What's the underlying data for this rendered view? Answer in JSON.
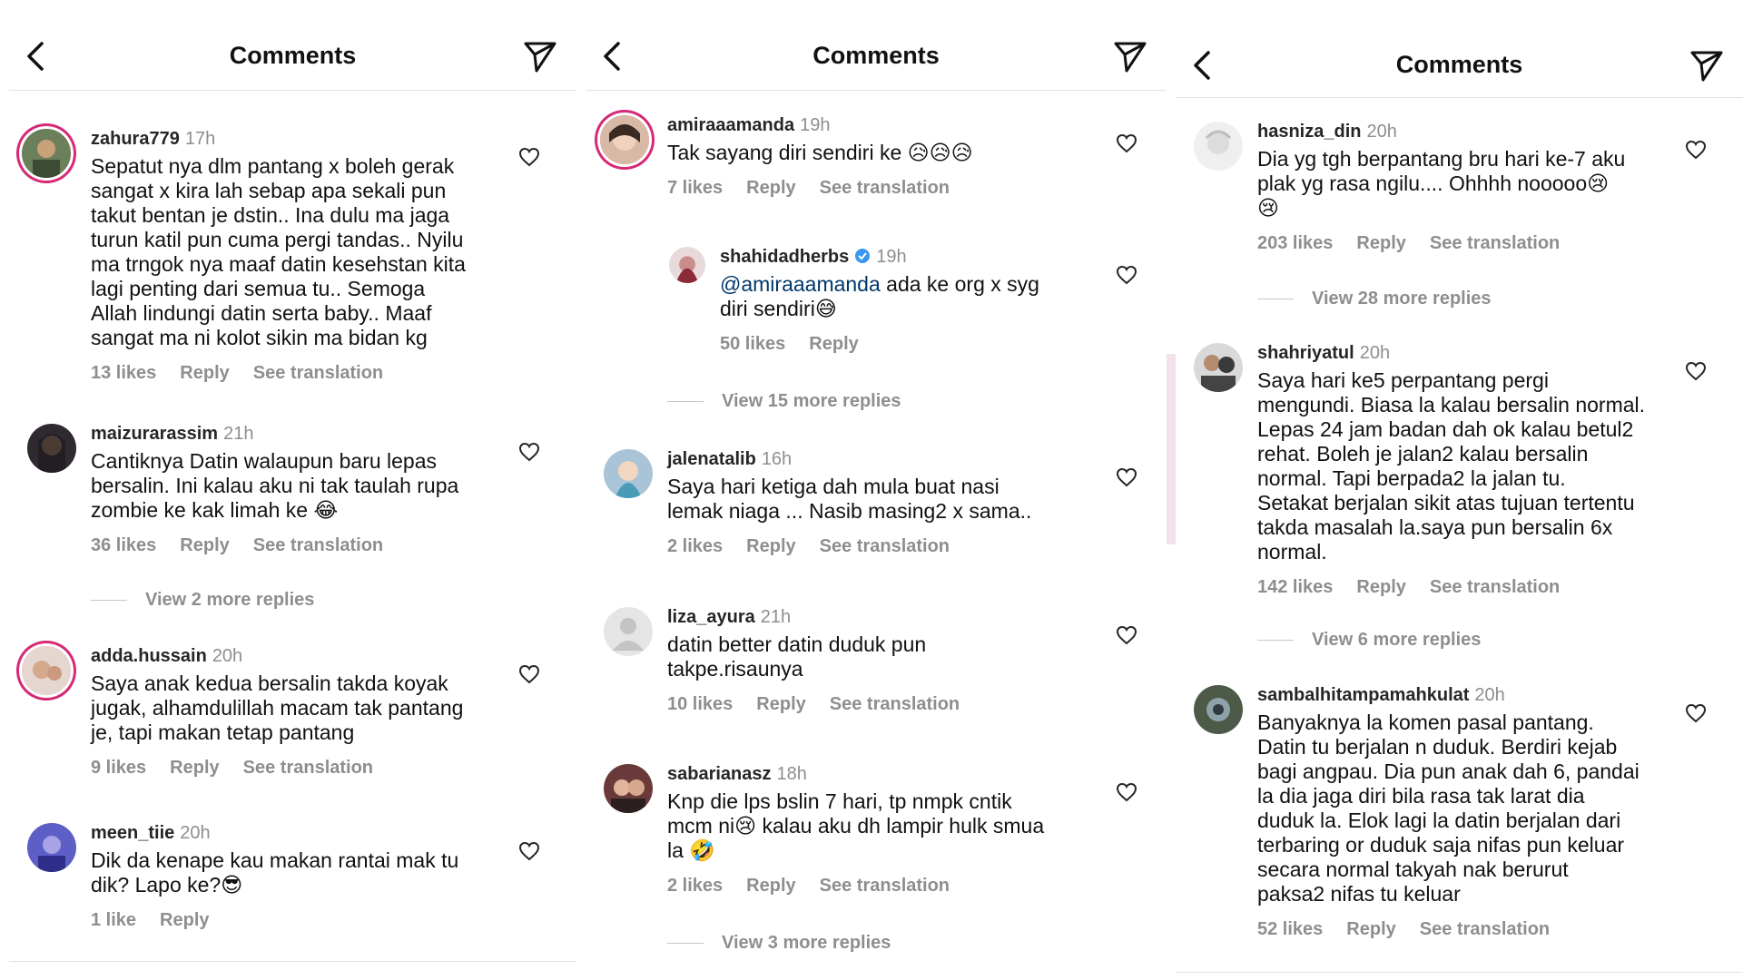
{
  "panels": [
    {
      "title": "Comments",
      "comments": [
        {
          "username": "zahura779",
          "time": "17h",
          "text": "Sepatut nya dlm pantang x boleh gerak\nsangat x kira lah sebap apa sekali pun\ntakut bentan je dstin.. Ina dulu ma jaga\nturun katil pun cuma pergi tandas.. Nyilu\nma trngok nya maaf datin kesehstan kita\nlagi penting dari semua tu.. Semoga\nAllah lindungi datin serta baby.. Maaf\nsangat ma ni kolot sikin ma bidan kg",
          "likes": "13 likes",
          "reply": "Reply",
          "translation": "See translation"
        },
        {
          "username": "maizurarassim",
          "time": "21h",
          "text": "Cantiknya Datin walaupun baru lepas\nbersalin. Ini kalau aku ni tak taulah rupa\nzombie ke kak limah ke 😂",
          "likes": "36 likes",
          "reply": "Reply",
          "translation": "See translation",
          "more_replies": "View 2 more replies"
        },
        {
          "username": "adda.hussain",
          "time": "20h",
          "text": "Saya anak kedua bersalin takda koyak\njugak, alhamdulillah macam tak pantang\nje, tapi makan tetap pantang",
          "likes": "9 likes",
          "reply": "Reply",
          "translation": "See translation"
        },
        {
          "username": "meen_tiie",
          "time": "20h",
          "text": "Dik da kenape kau makan rantai mak tu\ndik? Lapo ke?😎",
          "likes": "1 like",
          "reply": "Reply"
        }
      ]
    },
    {
      "title": "Comments",
      "comments": [
        {
          "username": "amiraaamanda",
          "time": "19h",
          "text": "Tak sayang diri sendiri ke 😥😥😥",
          "likes": "7 likes",
          "reply": "Reply",
          "translation": "See translation"
        },
        {
          "username": "shahidadherbs",
          "time": "19h",
          "mention": "@amiraaamanda",
          "text": " ada ke org x syg\ndiri sendiri😅",
          "likes": "50 likes",
          "reply": "Reply",
          "more_replies": "View 15 more replies"
        },
        {
          "username": "jalenatalib",
          "time": "16h",
          "text": "Saya hari ketiga dah mula buat nasi\nlemak niaga ... Nasib masing2 x sama..",
          "likes": "2 likes",
          "reply": "Reply",
          "translation": "See translation"
        },
        {
          "username": "liza_ayura",
          "time": "21h",
          "text": "datin better datin duduk pun\ntakpe.risaunya",
          "likes": "10 likes",
          "reply": "Reply",
          "translation": "See translation"
        },
        {
          "username": "sabarianasz",
          "time": "18h",
          "text": "Knp die lps bslin 7 hari, tp nmpk cntik\nmcm ni😢 kalau aku dh lampir hulk smua\nla 🤣",
          "likes": "2 likes",
          "reply": "Reply",
          "translation": "See translation",
          "more_replies": "View 3 more replies"
        }
      ]
    },
    {
      "title": "Comments",
      "comments": [
        {
          "username": "hasniza_din",
          "time": "20h",
          "text": "Dia yg tgh berpantang bru hari ke-7 aku\nplak yg rasa ngilu.... Ohhhh nooooo😢\n😢",
          "likes": "203 likes",
          "reply": "Reply",
          "translation": "See translation",
          "more_replies": "View 28 more replies"
        },
        {
          "username": "shahriyatul",
          "time": "20h",
          "text": "Saya hari ke5 perpantang pergi\nmengundi. Biasa la kalau bersalin normal.\nLepas 24 jam badan dah ok kalau betul2\nrehat. Boleh je jalan2 kalau bersalin\nnormal. Tapi berpada2 la jalan tu.\nSetakat berjalan sikit atas tujuan tertentu\ntakda masalah la.saya pun bersalin 6x\nnormal.",
          "likes": "142 likes",
          "reply": "Reply",
          "translation": "See translation",
          "more_replies": "View 6 more replies"
        },
        {
          "username": "sambalhitampamahkulat",
          "time": "20h",
          "text": "Banyaknya la komen pasal pantang.\nDatin tu berjalan n duduk. Berdiri kejab\nbagi angpau. Dia pun anak dah 6, pandai\nla dia jaga diri bila rasa tak larat dia\nduduk la. Elok lagi la datin berjalan dari\nterbaring or duduk saja nifas pun keluar\nsecara normal takyah nak berurut\npaksa2 nifas tu keluar",
          "likes": "52 likes",
          "reply": "Reply",
          "translation": "See translation"
        }
      ]
    }
  ],
  "colors": {
    "text": "#262626",
    "muted": "#8e8e8e",
    "mention": "#00376b",
    "verified": "#3897f0",
    "story_ring": "#d62976"
  },
  "icons": {
    "back": "chevron-left-icon",
    "filter": "send-icon",
    "like": "heart-icon",
    "verified": "verified-badge-icon"
  }
}
